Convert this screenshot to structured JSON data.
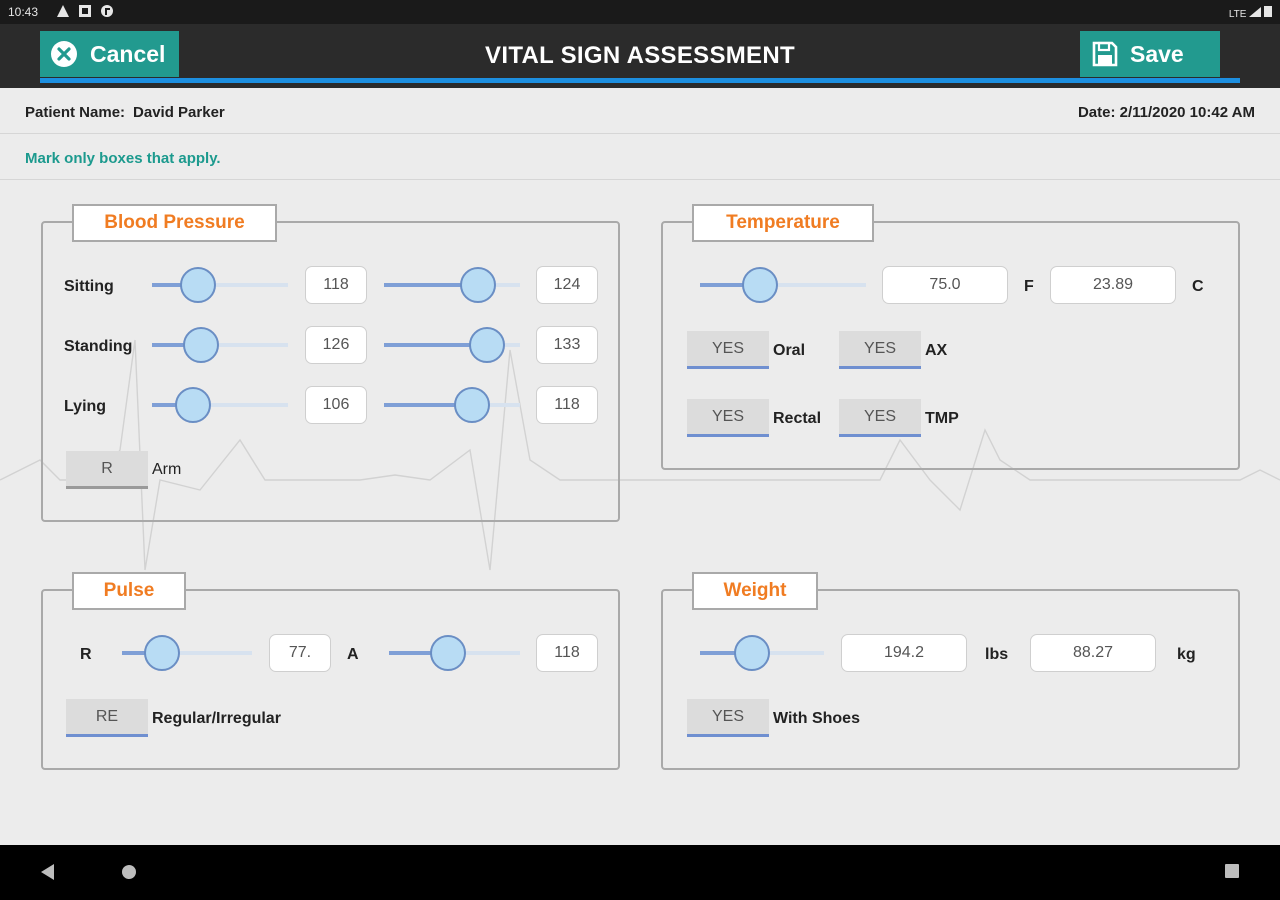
{
  "status": {
    "time": "10:43",
    "network": "LTE"
  },
  "header": {
    "title": "VITAL SIGN ASSESSMENT",
    "cancel_label": "Cancel",
    "save_label": "Save"
  },
  "patient": {
    "name_label": "Patient Name:",
    "name": "David Parker",
    "date": "Date: 2/11/2020 10:42 AM"
  },
  "instruction": "Mark only boxes that apply.",
  "colors": {
    "accent_teal": "#229a8f",
    "accent_orange": "#f07c22",
    "header_bg": "#2b2b2b",
    "header_line": "#1d8fe0"
  },
  "blood_pressure": {
    "title": "Blood Pressure",
    "rows": [
      {
        "label": "Sitting",
        "systolic_level": 0.34,
        "systolic": "118",
        "diastolic_level": 0.69,
        "diastolic": "124"
      },
      {
        "label": "Standing",
        "systolic_level": 0.36,
        "systolic": "126",
        "diastolic_level": 0.76,
        "diastolic": "133"
      },
      {
        "label": "Lying",
        "systolic_level": 0.3,
        "systolic": "106",
        "diastolic_level": 0.65,
        "diastolic": "118"
      }
    ],
    "arm_toggle": "R",
    "arm_label": "Arm"
  },
  "temperature": {
    "title": "Temperature",
    "slider_level": 0.36,
    "fahrenheit": "75.0",
    "f_unit": "F",
    "celsius": "23.89",
    "c_unit": "C",
    "options": [
      {
        "toggle": "YES",
        "label": "Oral"
      },
      {
        "toggle": "YES",
        "label": "AX"
      },
      {
        "toggle": "YES",
        "label": "Rectal"
      },
      {
        "toggle": "YES",
        "label": "TMP"
      }
    ]
  },
  "pulse": {
    "title": "Pulse",
    "r_label": "R",
    "r_level": 0.31,
    "r_value": "77.",
    "a_label": "A",
    "a_level": 0.45,
    "a_value": "118",
    "regularity_toggle": "RE",
    "regularity_label": "Regular/Irregular"
  },
  "weight": {
    "title": "Weight",
    "slider_level": 0.42,
    "lbs": "194.2",
    "lbs_unit": "lbs",
    "kg": "88.27",
    "kg_unit": "kg",
    "shoes_toggle": "YES",
    "shoes_label": "With Shoes"
  }
}
